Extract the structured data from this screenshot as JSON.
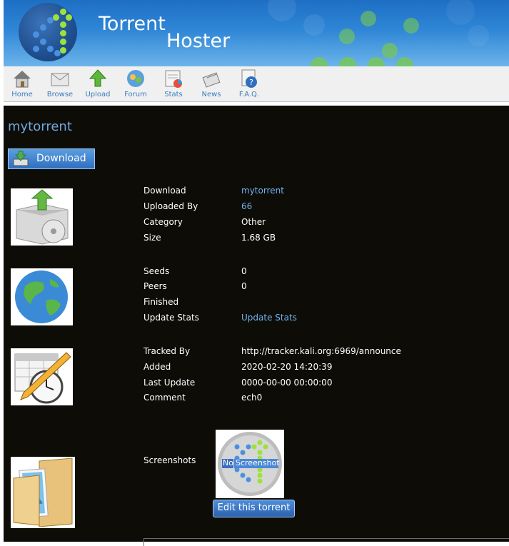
{
  "banner": {
    "title_line1": "Torrent",
    "title_line2": "Hoster"
  },
  "nav": {
    "items": [
      {
        "label": "Home",
        "icon": "home-icon"
      },
      {
        "label": "Browse",
        "icon": "browse-icon"
      },
      {
        "label": "Upload",
        "icon": "upload-icon"
      },
      {
        "label": "Forum",
        "icon": "forum-icon"
      },
      {
        "label": "Stats",
        "icon": "stats-icon"
      },
      {
        "label": "News",
        "icon": "news-icon"
      },
      {
        "label": "F.A.Q.",
        "icon": "faq-icon"
      }
    ]
  },
  "torrent": {
    "title": "mytorrent",
    "download_button": "Download",
    "info": {
      "download_label": "Download",
      "download_value": "mytorrent",
      "uploaded_by_label": "Uploaded By",
      "uploaded_by_value": "66",
      "category_label": "Category",
      "category_value": "Other",
      "size_label": "Size",
      "size_value": "1.68 GB"
    },
    "stats": {
      "seeds_label": "Seeds",
      "seeds_value": "0",
      "peers_label": "Peers",
      "peers_value": "0",
      "finished_label": "Finished",
      "finished_value": "",
      "update_label": "Update Stats",
      "update_value": "Update Stats"
    },
    "tracking": {
      "tracked_by_label": "Tracked By",
      "tracked_by_value": "http://tracker.kali.org:6969/announce",
      "added_label": "Added",
      "added_value": "2020-02-20 14:20:39",
      "last_update_label": "Last Update",
      "last_update_value": "0000-00-00 00:00:00",
      "comment_label": "Comment",
      "comment_value": "ech0"
    },
    "screenshots": {
      "label": "Screenshots",
      "placeholder_no": "No",
      "placeholder_text": "Screenshot",
      "edit_button": "Edit this torrent"
    }
  },
  "colors": {
    "accent": "#6fa8dc",
    "link": "#6fb3f0",
    "panel_bg": "#0e0c07",
    "nav_label": "#3b7bbf"
  }
}
